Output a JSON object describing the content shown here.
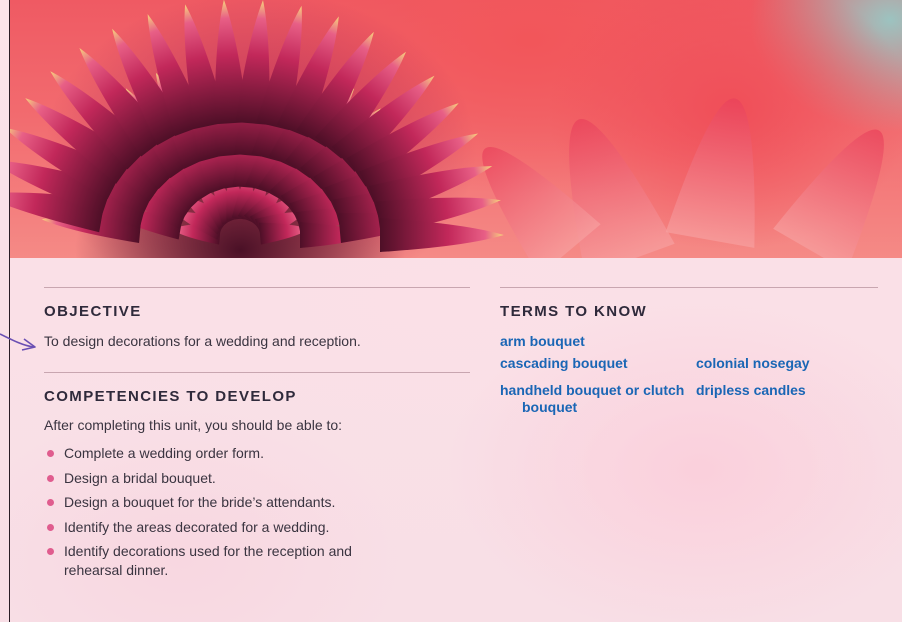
{
  "colors": {
    "heading": "#2f2a3b",
    "body": "#3a3440",
    "term": "#1a66b5",
    "bullet": "#e05c8e",
    "arrow": "#6a4fb3",
    "rule": "#c8a6b0"
  },
  "hero": {
    "icon": "flower-photo"
  },
  "objective": {
    "heading": "OBJECTIVE",
    "text": "To design decorations for a wedding and reception."
  },
  "competencies": {
    "heading": "COMPETENCIES TO DEVELOP",
    "intro": "After completing this unit, you should be able to:",
    "items": [
      "Complete a wedding order form.",
      "Design a bridal bouquet.",
      "Design a bouquet for the bride’s attendants.",
      "Identify the areas decorated for a wedding.",
      "Identify decorations used for the reception and rehearsal dinner."
    ]
  },
  "terms": {
    "heading": "TERMS TO KNOW",
    "column1": [
      "arm bouquet",
      "cascading bouquet",
      "handheld bouquet or clutch bouquet"
    ],
    "column2": [
      "colonial nosegay",
      "dripless candles"
    ]
  }
}
